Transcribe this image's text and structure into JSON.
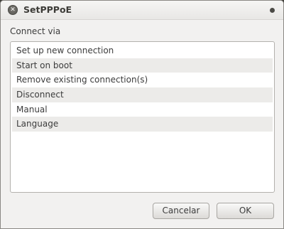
{
  "window": {
    "title": "SetPPPoE",
    "close_glyph": "✕"
  },
  "form": {
    "connect_label": "Connect via"
  },
  "list": {
    "items": [
      "Set up new connection",
      "Start on boot",
      "Remove existing connection(s)",
      "Disconnect",
      "Manual",
      "Language"
    ]
  },
  "buttons": {
    "cancel_label": "Cancelar",
    "ok_label": "OK"
  }
}
